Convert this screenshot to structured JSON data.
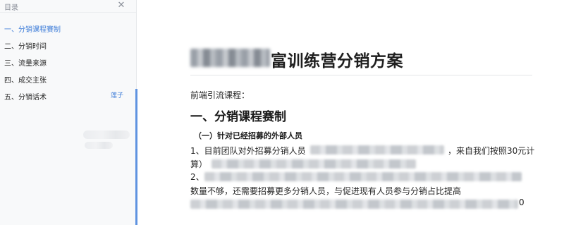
{
  "sidebar": {
    "title": "目录",
    "close_label": "✕",
    "items": [
      {
        "label": "一、分销课程赛制",
        "active": true
      },
      {
        "label": "二、分销时间",
        "active": false
      },
      {
        "label": "三、流量来源",
        "active": false
      },
      {
        "label": "四、成交主张",
        "active": false
      },
      {
        "label": "五、分销话术",
        "active": false
      }
    ],
    "side_link": "莲子"
  },
  "document": {
    "title_visible": "富训练营分销方案",
    "intro": "前端引流课程：",
    "heading1": "一、分销课程赛制",
    "heading3": "（一）针对已经招募的外部人员",
    "line1_start": "1、目前团队对外招募分销人员",
    "line1_end": "，来自我们按照30元计",
    "line2_start": "算）",
    "line3_start": "2、",
    "line4": "数量不够，还需要招募更多分销人员，与促进现有人员参与分销占比提高",
    "line5_end": "0"
  },
  "colors": {
    "accent": "#3b7bd8",
    "sidebar_bg": "#f8f9fa",
    "text": "#262626"
  }
}
